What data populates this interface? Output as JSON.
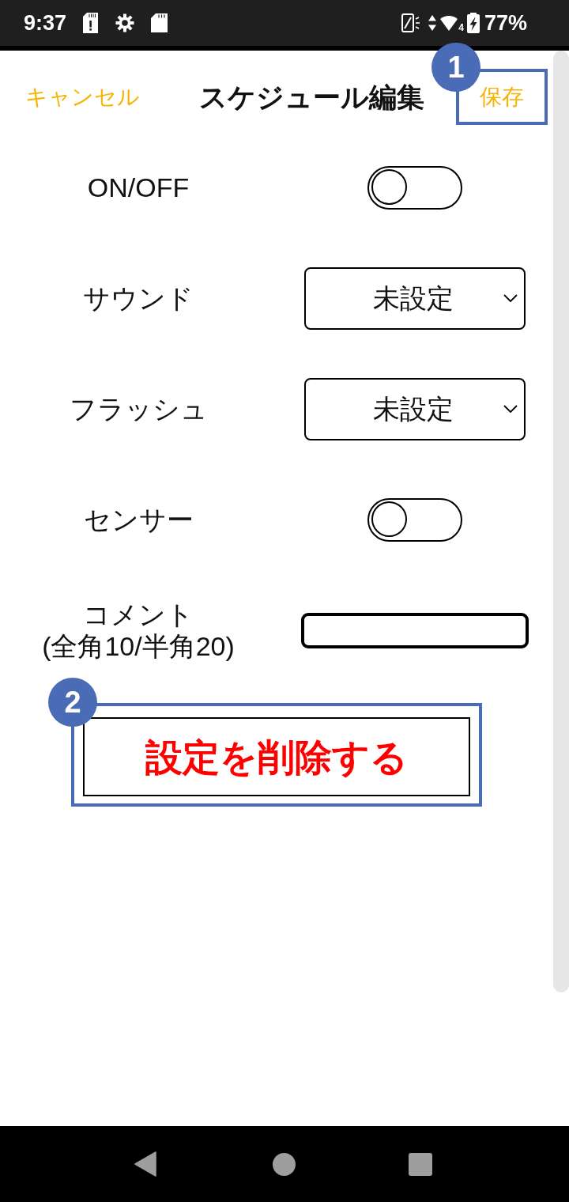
{
  "status_bar": {
    "time": "9:37",
    "network_label": "4",
    "battery": "77%"
  },
  "header": {
    "cancel_button": "キャンセル",
    "title": "スケジュール編集",
    "save_button": {
      "label": "保存",
      "callout": "1"
    }
  },
  "settings": [
    {
      "kind": "toggle",
      "label": "ON/OFF",
      "on": false
    },
    {
      "kind": "select",
      "label": "サウンド",
      "value": "未設定"
    },
    {
      "kind": "select",
      "label": "フラッシュ",
      "value": "未設定"
    },
    {
      "kind": "toggle",
      "label": "センサー",
      "on": false
    },
    {
      "kind": "text_input",
      "label": "コメント",
      "note": "(全角10/半角20)"
    }
  ],
  "delete_button": {
    "label": "設定を削除する",
    "callout": "2"
  }
}
